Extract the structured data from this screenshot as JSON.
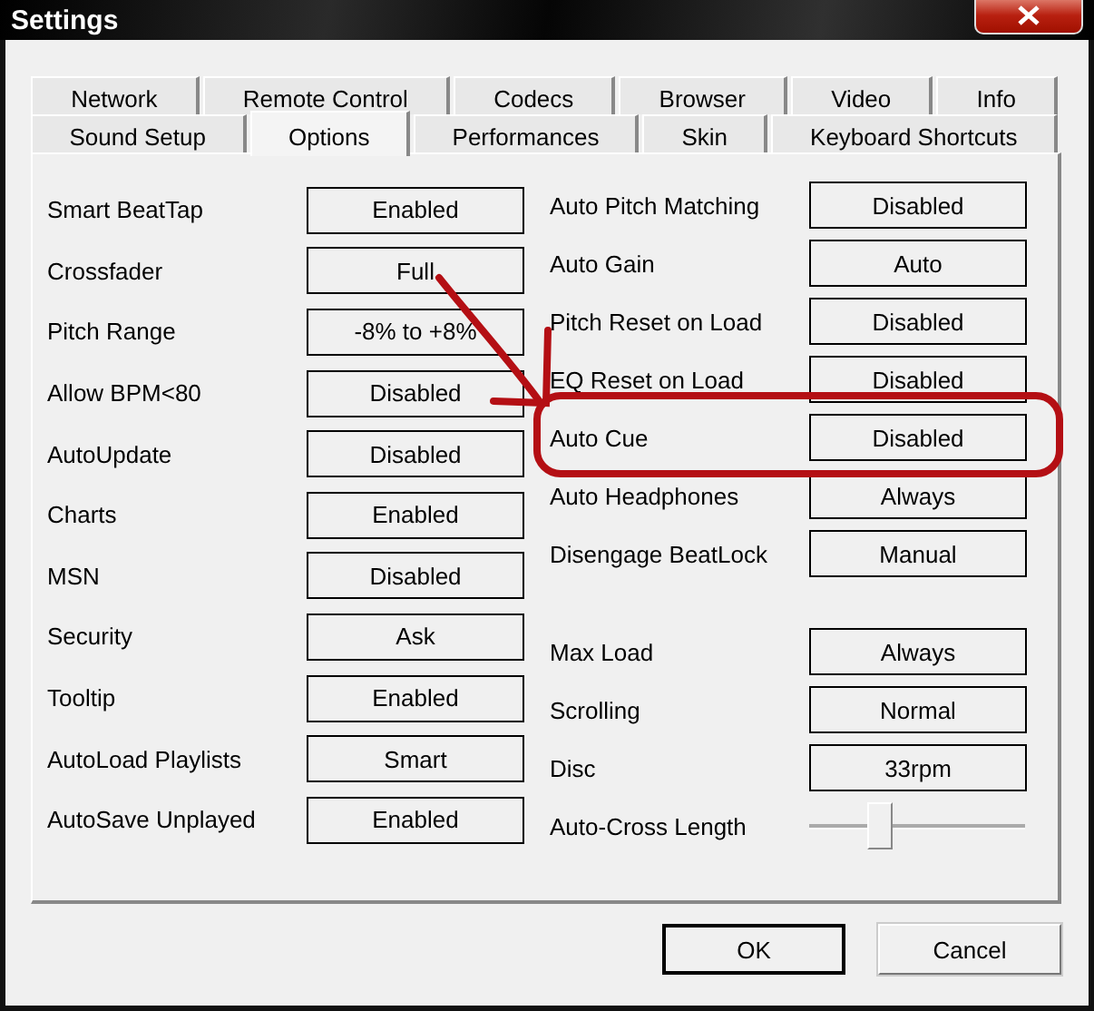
{
  "window": {
    "title": "Settings"
  },
  "tab_rows": [
    {
      "tabs": [
        {
          "label": "Network",
          "selected": false
        },
        {
          "label": "Remote Control",
          "selected": false
        },
        {
          "label": "Codecs",
          "selected": false
        },
        {
          "label": "Browser",
          "selected": false
        },
        {
          "label": "Video",
          "selected": false
        },
        {
          "label": "Info",
          "selected": false
        }
      ]
    },
    {
      "tabs": [
        {
          "label": "Sound Setup",
          "selected": false
        },
        {
          "label": "Options",
          "selected": true
        },
        {
          "label": "Performances",
          "selected": false
        },
        {
          "label": "Skin",
          "selected": false
        },
        {
          "label": "Keyboard Shortcuts",
          "selected": false
        }
      ]
    }
  ],
  "left_options": [
    {
      "kind": "value",
      "label": "Smart BeatTap",
      "value": "Enabled"
    },
    {
      "kind": "value",
      "label": "Crossfader",
      "value": "Full"
    },
    {
      "kind": "value",
      "label": "Pitch Range",
      "value": "-8% to +8%"
    },
    {
      "kind": "value",
      "label": "Allow BPM<80",
      "value": "Disabled"
    },
    {
      "kind": "value",
      "label": "AutoUpdate",
      "value": "Disabled"
    },
    {
      "kind": "value",
      "label": "Charts",
      "value": "Enabled"
    },
    {
      "kind": "value",
      "label": "MSN",
      "value": "Disabled"
    },
    {
      "kind": "value",
      "label": "Security",
      "value": "Ask"
    },
    {
      "kind": "value",
      "label": "Tooltip",
      "value": "Enabled"
    },
    {
      "kind": "value",
      "label": "AutoLoad Playlists",
      "value": "Smart"
    },
    {
      "kind": "value",
      "label": "AutoSave Unplayed",
      "value": "Enabled"
    }
  ],
  "right_groups": [
    {
      "options": [
        {
          "kind": "value",
          "label": "Auto Pitch Matching",
          "value": "Disabled"
        },
        {
          "kind": "value",
          "label": "Auto Gain",
          "value": "Auto"
        },
        {
          "kind": "value",
          "label": "Pitch Reset on Load",
          "value": "Disabled"
        },
        {
          "kind": "value",
          "label": "EQ Reset on Load",
          "value": "Disabled"
        },
        {
          "kind": "value",
          "label": "Auto Cue",
          "value": "Disabled"
        },
        {
          "kind": "value",
          "label": "Auto Headphones",
          "value": "Always"
        },
        {
          "kind": "value",
          "label": "Disengage BeatLock",
          "value": "Manual"
        }
      ]
    },
    {
      "options": [
        {
          "kind": "value",
          "label": "Max Load",
          "value": "Always"
        },
        {
          "kind": "value",
          "label": "Scrolling",
          "value": "Normal"
        },
        {
          "kind": "value",
          "label": "Disc",
          "value": "33rpm"
        },
        {
          "kind": "slider",
          "label": "Auto-Cross Length",
          "level": 0.3
        }
      ]
    }
  ],
  "buttons": [
    {
      "label": "OK",
      "default": true
    },
    {
      "label": "Cancel",
      "default": false
    }
  ]
}
